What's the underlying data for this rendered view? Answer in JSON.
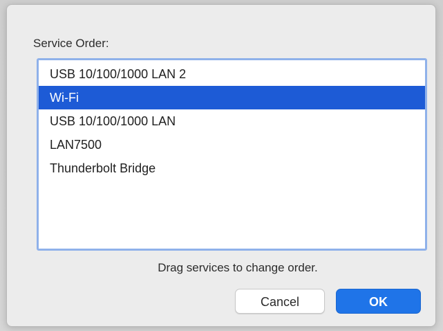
{
  "dialog": {
    "section_label": "Service Order:",
    "services": [
      {
        "label": "USB 10/100/1000 LAN 2",
        "selected": false
      },
      {
        "label": "Wi-Fi",
        "selected": true
      },
      {
        "label": "USB 10/100/1000 LAN",
        "selected": false
      },
      {
        "label": "LAN7500",
        "selected": false
      },
      {
        "label": "Thunderbolt Bridge",
        "selected": false
      }
    ],
    "hint": "Drag services to change order.",
    "cancel_label": "Cancel",
    "ok_label": "OK"
  },
  "colors": {
    "selection": "#1d5bd6",
    "accent_button": "#1f74e8",
    "focus_ring": "#8fb1ea",
    "sheet_background": "#ececec"
  }
}
